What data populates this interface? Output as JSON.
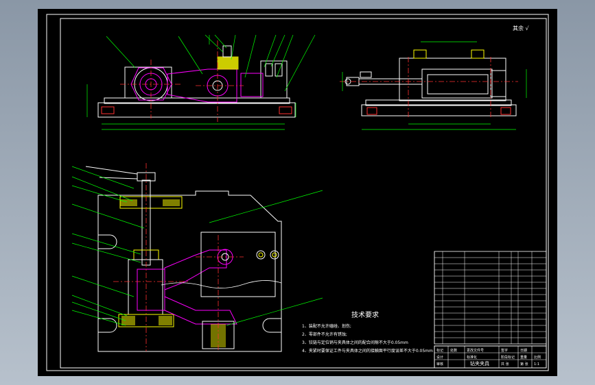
{
  "corner_note": "其余 √",
  "tech_title": "技术要求",
  "tech_reqs": [
    "1、装配不允许磕碰、划伤;",
    "2、零部件不允许有锈蚀;",
    "3、铰链与定位销与夹具体之间的配合间隙不大于0.05mm",
    "4、夹紧时要保证工件与夹具体之间的接触面平行度误差不大于0.05mm"
  ],
  "title_block": {
    "row1": [
      "标记",
      "处数",
      "更改文件号",
      "签字",
      "日期"
    ],
    "row2": [
      "设计",
      "",
      "标准化",
      "",
      "阶段标记",
      "重量",
      "比例"
    ],
    "part_name": "钻夹夹具",
    "scale": "1:1",
    "row3": [
      "审核",
      "",
      "批准",
      "",
      "共 张",
      "第 张"
    ]
  },
  "colors": {
    "bg": "#000000",
    "frame": "#ffffff",
    "part": "#ffffff",
    "leader": "#00ff00",
    "center": "#ff3030",
    "pin": "#ff00ff",
    "dim": "#00ff00",
    "hatch": "#ffff00",
    "text": "#ffffff"
  }
}
